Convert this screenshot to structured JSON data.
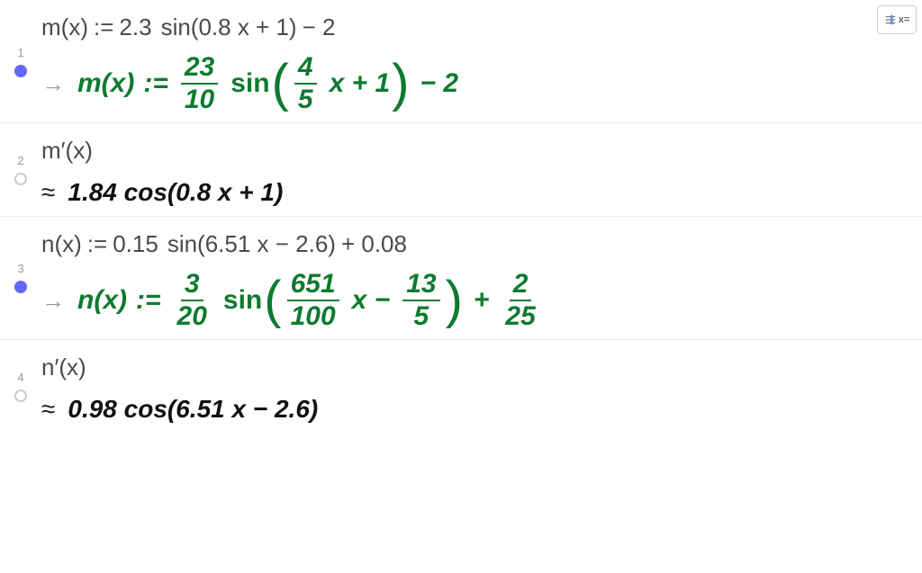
{
  "toolbar": {
    "slider_label": "x="
  },
  "rows": [
    {
      "index": "1",
      "marker": "filled",
      "input": {
        "fn": "m(x)",
        "assign": ":=",
        "a": "2.3",
        "op1": "sin(0.8 x + 1)",
        "tail": "− 2"
      },
      "output": {
        "prefix": "→",
        "fn": "m(x)",
        "assign": ":=",
        "frac1": {
          "n": "23",
          "d": "10"
        },
        "sin": "sin",
        "inner_frac": {
          "n": "4",
          "d": "5"
        },
        "inner_x": "x + 1",
        "tail": "− 2"
      }
    },
    {
      "index": "2",
      "marker": "empty",
      "input": {
        "raw": "m′(x)"
      },
      "output": {
        "prefix": "≈",
        "raw": "1.84  cos(0.8 x + 1)"
      }
    },
    {
      "index": "3",
      "marker": "filled",
      "input": {
        "fn": "n(x)",
        "assign": ":=",
        "a": "0.15",
        "op1": "sin(6.51 x − 2.6)",
        "tail": "+ 0.08"
      },
      "output": {
        "prefix": "→",
        "fn": "n(x)",
        "assign": ":=",
        "frac1": {
          "n": "3",
          "d": "20"
        },
        "sin": "sin",
        "inner_frac": {
          "n": "651",
          "d": "100"
        },
        "inner_x": "x −",
        "inner_frac2": {
          "n": "13",
          "d": "5"
        },
        "plus": "+",
        "frac2": {
          "n": "2",
          "d": "25"
        }
      }
    },
    {
      "index": "4",
      "marker": "empty",
      "input": {
        "raw": "n′(x)"
      },
      "output": {
        "prefix": "≈",
        "raw": "0.98  cos(6.51 x − 2.6)"
      }
    }
  ]
}
